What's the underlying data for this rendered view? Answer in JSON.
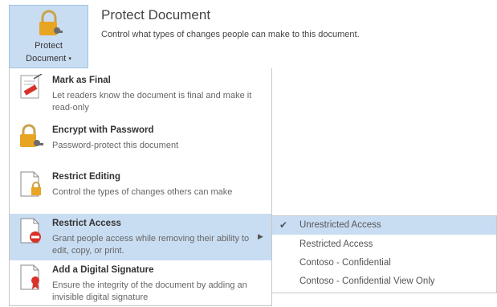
{
  "header": {
    "button_label_line1": "Protect",
    "button_label_line2": "Document",
    "title": "Protect Document",
    "description": "Control what types of changes people can make to this document."
  },
  "menu": {
    "items": [
      {
        "title": "Mark as Final",
        "description": "Let readers know the document is final and make it read-only",
        "icon": "mark-final-icon"
      },
      {
        "title": "Encrypt with Password",
        "description": "Password-protect this document",
        "icon": "lock-key-icon"
      },
      {
        "title": "Restrict Editing",
        "description": "Control the types of changes others can make",
        "icon": "document-lock-icon"
      },
      {
        "title": "Restrict Access",
        "description": "Grant people access while removing their ability to edit, copy, or print.",
        "icon": "document-block-icon"
      },
      {
        "title": "Add a Digital Signature",
        "description": "Ensure the integrity of the document by adding an invisible digital signature",
        "icon": "document-ribbon-icon"
      }
    ]
  },
  "submenu": {
    "items": [
      {
        "label": "Unrestricted Access",
        "checked": true
      },
      {
        "label": "Restricted Access",
        "checked": false
      },
      {
        "label": "Contoso - Confidential",
        "checked": false
      },
      {
        "label": "Contoso - Confidential View Only",
        "checked": false
      }
    ]
  },
  "colors": {
    "highlight": "#c9ddf2",
    "lock_gold": "#e8a423",
    "block_red": "#d9322b"
  }
}
